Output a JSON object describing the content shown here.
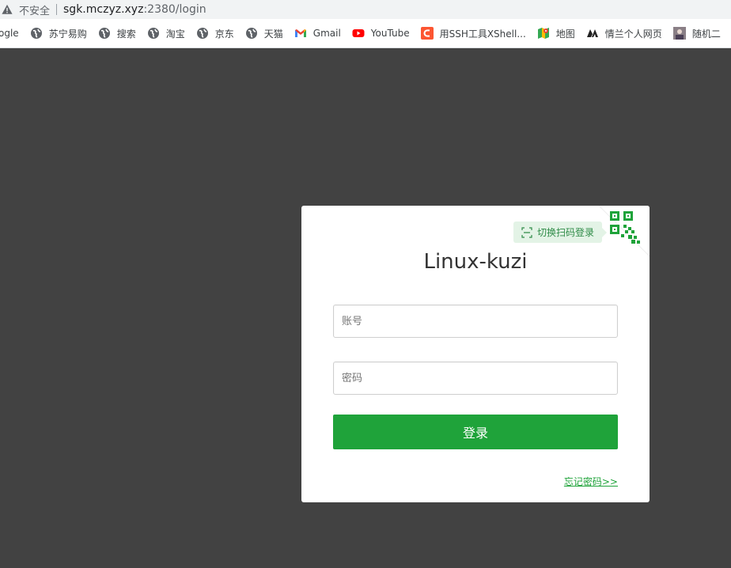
{
  "browser": {
    "security_label": "不安全",
    "url_host": "sgk.mczyz.xyz",
    "url_path": ":2380/login"
  },
  "bookmarks": [
    {
      "label": "ogle",
      "icon": "google-icon"
    },
    {
      "label": "苏宁易购",
      "icon": "globe-icon"
    },
    {
      "label": "搜索",
      "icon": "globe-icon"
    },
    {
      "label": "淘宝",
      "icon": "globe-icon"
    },
    {
      "label": "京东",
      "icon": "globe-icon"
    },
    {
      "label": "天猫",
      "icon": "globe-icon"
    },
    {
      "label": "Gmail",
      "icon": "gmail-icon"
    },
    {
      "label": "YouTube",
      "icon": "youtube-icon"
    },
    {
      "label": "用SSH工具XShell...",
      "icon": "csdn-icon"
    },
    {
      "label": "地图",
      "icon": "maps-icon"
    },
    {
      "label": "情兰个人网页",
      "icon": "site-logo-icon"
    },
    {
      "label": "随机二",
      "icon": "avatar-icon"
    }
  ],
  "login": {
    "qr_switch_label": "切换扫码登录",
    "title": "Linux-kuzi",
    "account_placeholder": "账号",
    "password_placeholder": "密码",
    "submit_label": "登录",
    "forgot_label": "忘记密码>>"
  },
  "colors": {
    "page_bg": "#424242",
    "accent_green": "#1fa33a",
    "qr_tip_bg": "#e3f3e6"
  }
}
